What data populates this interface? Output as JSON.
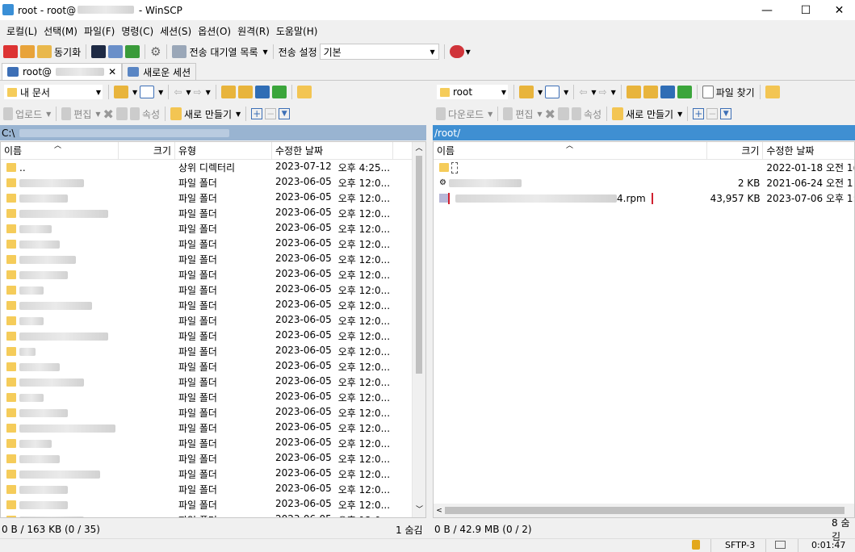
{
  "window": {
    "title": "root - root@",
    "suffix": " - WinSCP"
  },
  "menu": [
    "로컬(L)",
    "선택(M)",
    "파일(F)",
    "명령(C)",
    "세션(S)",
    "옵션(O)",
    "원격(R)",
    "도움말(H)"
  ],
  "toolbar": {
    "sync_label": "동기화",
    "queue_label": "전송 대기열 목록",
    "transfer_settings_label": "전송 설정",
    "transfer_settings_value": "기본"
  },
  "tabs": [
    {
      "label": "root@"
    },
    {
      "label": "새로운 세션"
    }
  ],
  "local": {
    "location": "내 문서",
    "actions": {
      "upload": "업로드",
      "edit": "편집",
      "properties": "속성",
      "new": "새로 만들기"
    },
    "path": "C:\\",
    "columns": [
      "이름",
      "크기",
      "유형",
      "수정한 날짜"
    ],
    "parent": {
      "name": "..",
      "type": "상위 디렉터리",
      "date": "2023-07-12",
      "time": "오후 4:25..."
    },
    "folder_type": "파일 폴더",
    "folder_date": "2023-06-05",
    "folder_time": "오후 12:0...",
    "status": "0 B / 163 KB (0 / 35)",
    "hidden": "1 숨김"
  },
  "remote": {
    "location": "root",
    "find_label": "파일 찾기",
    "actions": {
      "download": "다운로드",
      "edit": "편집",
      "properties": "속성",
      "new": "새로 만들기"
    },
    "path": "/root/",
    "columns": [
      "이름",
      "크기",
      "수정한 날짜"
    ],
    "rows": [
      {
        "name": "",
        "size": "",
        "date": "2022-01-18 오전 1("
      },
      {
        "name": "",
        "size": "2 KB",
        "date": "2021-06-24 오전 1"
      },
      {
        "name": "4.rpm",
        "size": "43,957 KB",
        "date": "2023-07-06 오후 1:"
      }
    ],
    "status": "0 B / 42.9 MB (0 / 2)",
    "hidden": "8 숨김"
  },
  "statusbar": {
    "protocol": "SFTP-3",
    "time": "0:01:47"
  }
}
